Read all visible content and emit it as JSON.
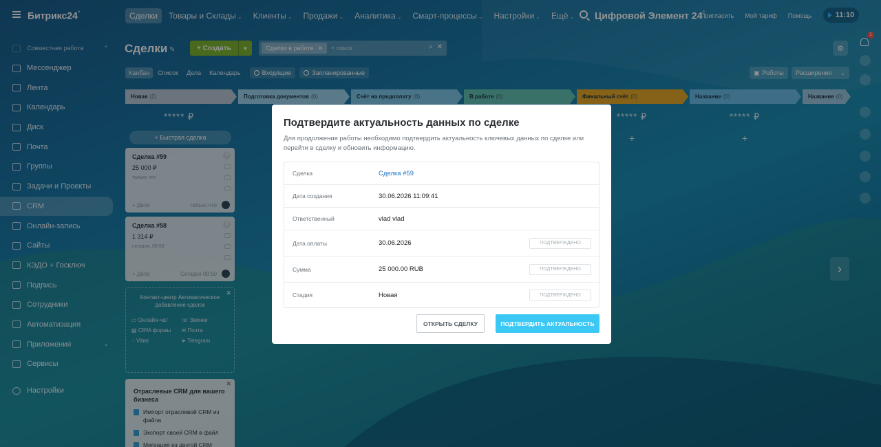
{
  "app": {
    "logo": "Битрикс24",
    "logo_mark": "°",
    "company": "Цифровой Элемент 24",
    "company_mark": "°",
    "time": "11:10"
  },
  "topnav": [
    "Сделки",
    "Товары и Склады",
    "Клиенты",
    "Продажи",
    "Аналитика",
    "Смарт-процессы",
    "Настройки",
    "Ещё"
  ],
  "top_links": [
    "Пригласить",
    "Мой тариф",
    "Помощь"
  ],
  "sidebar": {
    "group": "Совместная работа",
    "items": [
      "Мессенджер",
      "Лента",
      "Календарь",
      "Диск",
      "Почта",
      "Группы",
      "Задачи и Проекты",
      "CRM",
      "Онлайн-запись",
      "Сайты",
      "КЭДО + Госключ",
      "Подпись",
      "Сотрудники",
      "Автоматизация",
      "Приложения",
      "Сервисы"
    ],
    "settings": "Настройки"
  },
  "page": {
    "title": "Сделки",
    "create": "Создать",
    "filter_tag": "Сделки в работе",
    "search_placeholder": "+ поиск"
  },
  "views": [
    "Канбан",
    "Список",
    "Дела",
    "Календарь"
  ],
  "pills": [
    "Входящие",
    "Запланированные"
  ],
  "toolbar": {
    "robots": "Роботы",
    "extensions": "Расширения"
  },
  "stages": [
    {
      "name": "Новая",
      "count": "(2)",
      "color": "#b9c8d6"
    },
    {
      "name": "Подготовка документов",
      "count": "(0)",
      "color": "#9bd3ee"
    },
    {
      "name": "Счёт на предоплату",
      "count": "(0)",
      "color": "#7ec8e8"
    },
    {
      "name": "В работе",
      "count": "(0)",
      "color": "#63c3b6"
    },
    {
      "name": "Финальный счёт",
      "count": "(0)",
      "color": "#e5a928"
    },
    {
      "name": "Название",
      "count": "(0)",
      "color": "#6bbde8"
    },
    {
      "name": "Название",
      "count": "(0)",
      "color": "#9cc7e0"
    }
  ],
  "column_sum": "***** ₽",
  "quick_deal": "Быстрая сделка",
  "cards": [
    {
      "title": "Сделка #59",
      "sum": "25 000 ₽",
      "meta": "только что",
      "task": "+ Дело",
      "time": "только что",
      "badge": "0"
    },
    {
      "title": "Сделка #58",
      "sum": "1 314 ₽",
      "meta": "сегодня, 09:50",
      "task": "+ Дело",
      "time": "Сегодня 09:50",
      "badge": "0"
    }
  ],
  "contact_center": {
    "heading": "Контакт-центр Автоматическое добавление сделок",
    "channels": [
      "Онлайн-чат",
      "Звонки",
      "CRM-формы",
      "Почта",
      "Viber",
      "Telegram"
    ]
  },
  "promo": {
    "heading": "Отраслевые CRM для вашего бизнеса",
    "items": [
      "Импорт отраслевой CRM из файла",
      "Экспорт своей CRM в файл",
      "Миграция из другой CRM"
    ]
  },
  "notifications": {
    "count": "1"
  },
  "modal": {
    "title": "Подтвердите актуальность данных по сделке",
    "description": "Для продолжения работы необходимо подтвердить актуальность ключевых данных по сделке или перейти в сделку и обновить информацию.",
    "rows": [
      {
        "label": "Сделка",
        "value": "Сделка #59",
        "status": ""
      },
      {
        "label": "Дата создания",
        "value": "30.06.2026 11:09:41",
        "status": ""
      },
      {
        "label": "Ответственный",
        "value": "vlad vlad",
        "status": ""
      },
      {
        "label": "Дата оплаты",
        "value": "30.06.2026",
        "status": "ПОДТВЕРЖДЕНО"
      },
      {
        "label": "Сумма",
        "value": "25 000.00 RUB",
        "status": "ПОДТВЕРЖДЕНО"
      },
      {
        "label": "Стадия",
        "value": "Новая",
        "status": "ПОДТВЕРЖДЕНО"
      }
    ],
    "open_button": "ОТКРЫТЬ СДЕЛКУ",
    "confirm_button": "ПОДТВЕРДИТЬ АКТУАЛЬНОСТЬ"
  }
}
